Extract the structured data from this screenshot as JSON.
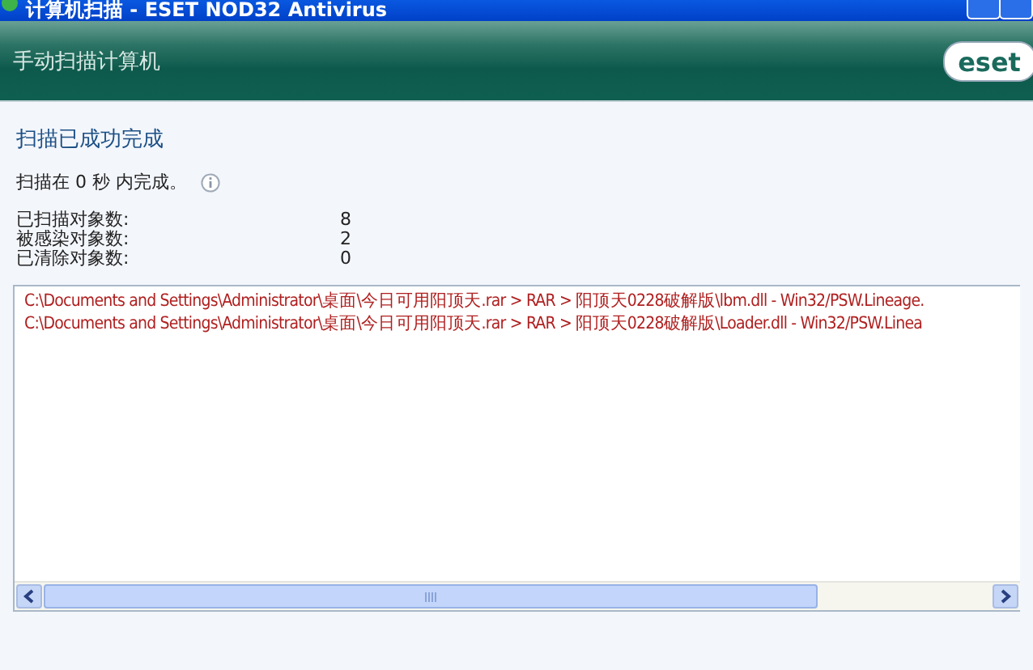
{
  "window": {
    "title": "计算机扫描 - ESET NOD32 Antivirus"
  },
  "header": {
    "title": "手动扫描计算机",
    "logo": "eset"
  },
  "result": {
    "heading": "扫描已成功完成",
    "duration": "扫描在 0 秒 内完成。"
  },
  "stats": [
    {
      "label": "已扫描对象数:",
      "value": "8"
    },
    {
      "label": "被感染对象数:",
      "value": "2"
    },
    {
      "label": "已清除对象数:",
      "value": "0"
    }
  ],
  "log": [
    "C:\\Documents and Settings\\Administrator\\桌面\\今日可用阳顶天.rar > RAR > 阳顶天0228破解版\\lbm.dll - Win32/PSW.Lineage.",
    "C:\\Documents and Settings\\Administrator\\桌面\\今日可用阳顶天.rar > RAR > 阳顶天0228破解版\\Loader.dll - Win32/PSW.Linea"
  ]
}
